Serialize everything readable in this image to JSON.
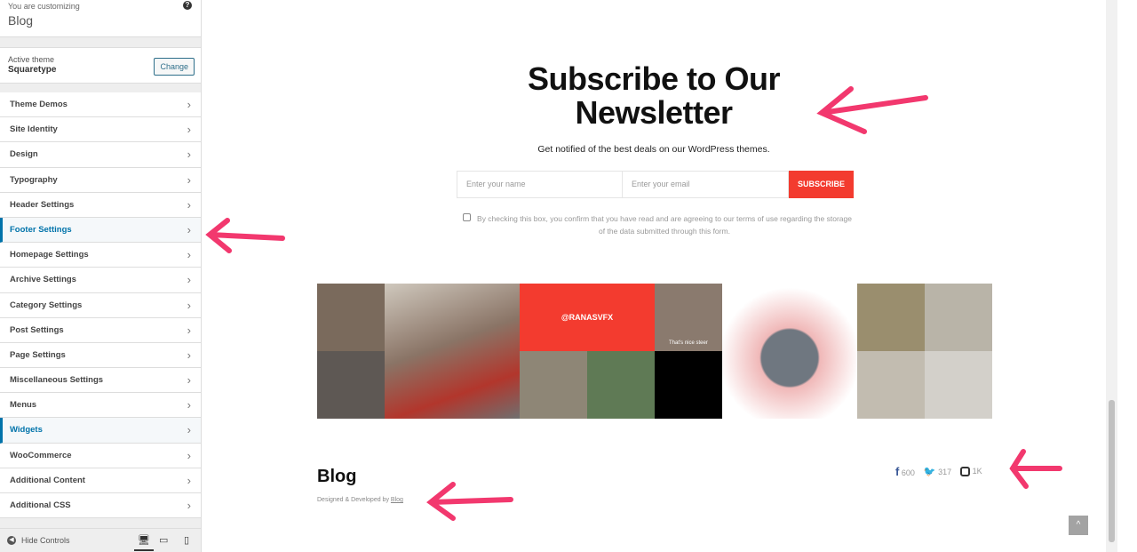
{
  "sidebar": {
    "customizing_label": "You are customizing",
    "site_name": "Blog",
    "active_theme_label": "Active theme",
    "theme_name": "Squaretype",
    "change_label": "Change",
    "items": [
      {
        "label": "Theme Demos"
      },
      {
        "label": "Site Identity"
      },
      {
        "label": "Design"
      },
      {
        "label": "Typography"
      },
      {
        "label": "Header Settings"
      },
      {
        "label": "Footer Settings"
      },
      {
        "label": "Homepage Settings"
      },
      {
        "label": "Archive Settings"
      },
      {
        "label": "Category Settings"
      },
      {
        "label": "Post Settings"
      },
      {
        "label": "Page Settings"
      },
      {
        "label": "Miscellaneous Settings"
      },
      {
        "label": "Menus"
      },
      {
        "label": "Widgets"
      },
      {
        "label": "WooCommerce"
      },
      {
        "label": "Additional Content"
      },
      {
        "label": "Additional CSS"
      }
    ],
    "hide_controls": "Hide Controls"
  },
  "newsletter": {
    "title": "Subscribe to Our Newsletter",
    "subtitle": "Get notified of the best deals on our WordPress themes.",
    "name_placeholder": "Enter your name",
    "email_placeholder": "Enter your email",
    "subscribe_label": "SUBSCRIBE",
    "consent": "By checking this box, you confirm that you have read and are agreeing to our terms of use regarding the storage of the data submitted through this form."
  },
  "instagram": {
    "handle": "@RANASVFX",
    "caption": "That's nice steer"
  },
  "footer": {
    "site_title": "Blog",
    "credit_prefix": "Designed & Developed by",
    "credit_link": "Blog",
    "facebook_count": "600",
    "twitter_count": "317",
    "instagram_count": "1K"
  },
  "colors": {
    "accent": "#f33b2f",
    "annotation": "#f2386e",
    "link": "#0073aa"
  }
}
